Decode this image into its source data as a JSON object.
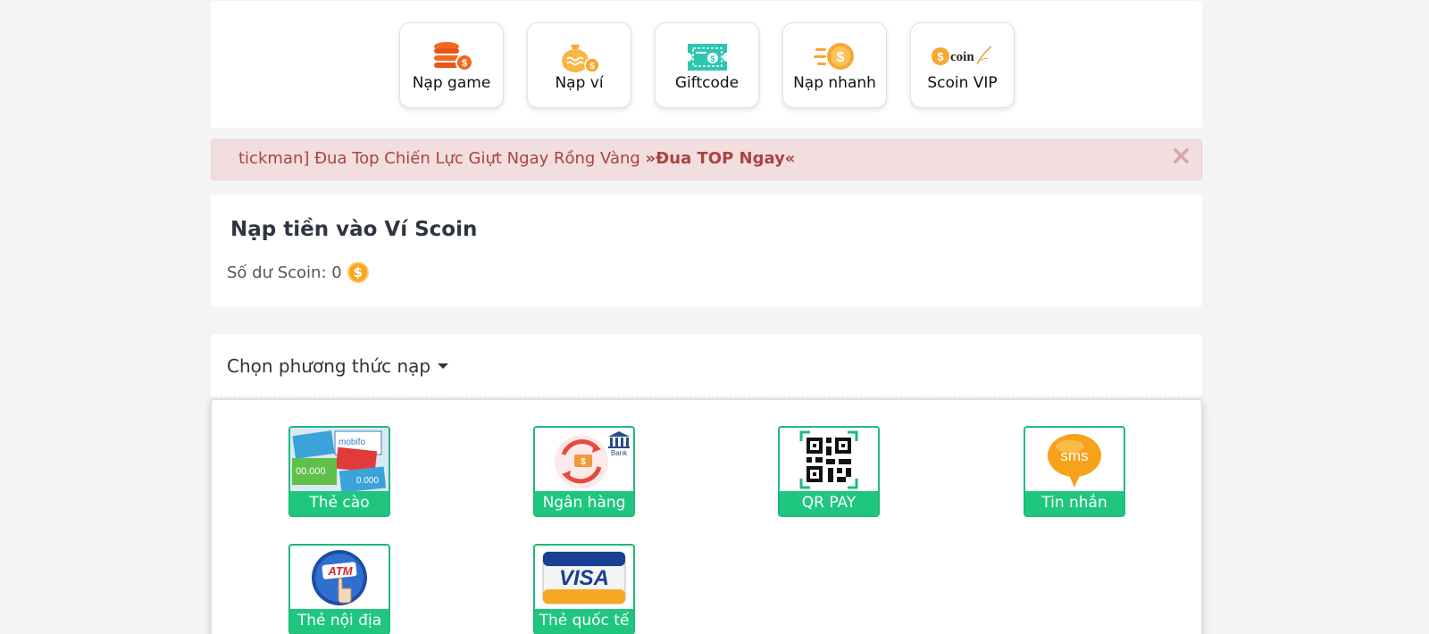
{
  "nav": {
    "items": [
      {
        "label": "Nạp game",
        "icon": "coin-stack-icon"
      },
      {
        "label": "Nạp ví",
        "icon": "money-bag-icon"
      },
      {
        "label": "Giftcode",
        "icon": "ticket-icon"
      },
      {
        "label": "Nạp nhanh",
        "icon": "fast-coin-icon"
      },
      {
        "label": "Scoin VIP",
        "icon": "scoin-vip-logo"
      }
    ]
  },
  "alert": {
    "text": "tickman] Đua Top Chiến Lực Giựt Ngay Rồng Vàng ",
    "link": "»Đua TOP Ngay«",
    "close": "×"
  },
  "wallet": {
    "title": "Nạp tiền vào Ví Scoin",
    "balance_label": "Số dư Scoin: 0",
    "coin_symbol": "$"
  },
  "method": {
    "label": "Chọn phương thức nạp",
    "options": [
      {
        "label": "Thẻ cào",
        "icon": "scratch-card-icon"
      },
      {
        "label": "Ngân hàng",
        "icon": "bank-icon",
        "badge": "Bank"
      },
      {
        "label": "QR PAY",
        "icon": "qr-code-icon"
      },
      {
        "label": "Tin nhắn",
        "icon": "sms-icon",
        "badge": "sms"
      },
      {
        "label": "Thẻ nội địa",
        "icon": "atm-card-icon",
        "badge": "ATM"
      },
      {
        "label": "Thẻ quốc tế",
        "icon": "visa-card-icon",
        "badge": "VISA"
      }
    ]
  },
  "colors": {
    "accent": "#1fc77e",
    "alert_text": "#a94442",
    "coin": "#f6a623"
  }
}
